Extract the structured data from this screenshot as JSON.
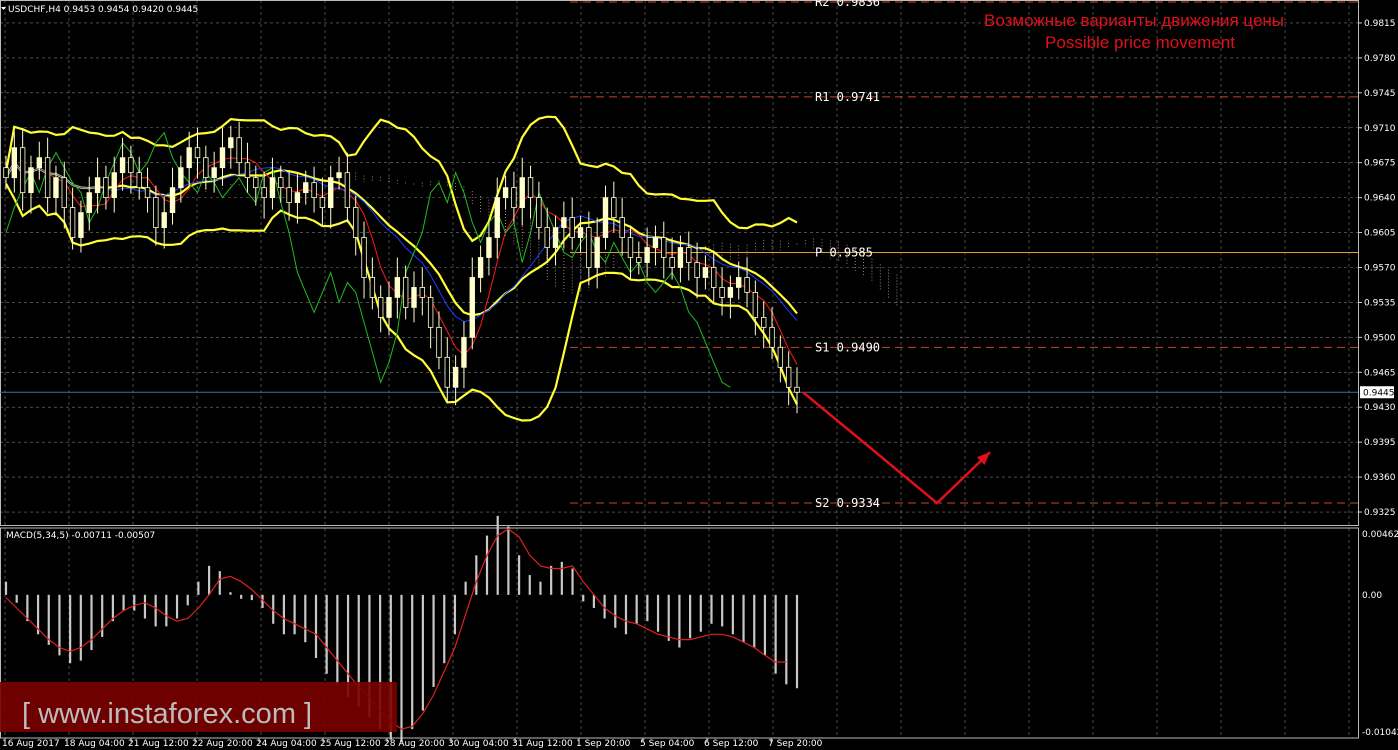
{
  "header": {
    "symbol_line": "USDCHF,H4  0.9453 0.9454 0.9420 0.9445",
    "macd_line": "MACD(5,34,5) -0.00711 -0.00507"
  },
  "title": {
    "line_ru": "Возможные варианты движения цены",
    "line_en": "Possible price movement",
    "color": "#e0101a"
  },
  "watermark": "[ www.instaforex.com ]",
  "colors": {
    "background": "#000000",
    "grid": "#7a7a7a",
    "bollinger": "#ffff33",
    "ichimoku_tenkan": "#ff1a1a",
    "ichimoku_kijun": "#1a3cff",
    "chikou": "#22bb22",
    "bull_candle": "#ffffcc",
    "bear_candle": "#000000",
    "level_line": "#c8462a",
    "pivot_line": "#e0a030",
    "current_price_line": "#4a6a9a",
    "arrow": "#e0101a",
    "macd_hist": "#c8c8c8",
    "macd_signal": "#e02020"
  },
  "chart_data": [
    {
      "type": "line",
      "symbol": "USDCHF",
      "timeframe": "H4",
      "ohlc": {
        "open": 0.9453,
        "high": 0.9454,
        "low": 0.942,
        "close": 0.9445
      },
      "y_axis_ticks": [
        "0.9815",
        "0.9780",
        "0.9745",
        "0.9710",
        "0.9675",
        "0.9640",
        "0.9605",
        "0.9570",
        "0.9535",
        "0.9500",
        "0.9465",
        "0.9430",
        "0.9395",
        "0.9360",
        "0.9325"
      ],
      "ylim": [
        0.9312,
        0.9838
      ],
      "current_price": "0.9445",
      "x_tick_labels": [
        "16 Aug 2017",
        "18 Aug 04:00",
        "21 Aug 12:00",
        "22 Aug 20:00",
        "24 Aug 04:00",
        "25 Aug 12:00",
        "28 Aug 20:00",
        "30 Aug 04:00",
        "31 Aug 12:00",
        "1 Sep 20:00",
        "5 Sep 04:00",
        "6 Sep 12:00",
        "7 Sep 20:00"
      ],
      "pivot_levels": [
        {
          "label": "R2",
          "value": "0.9836"
        },
        {
          "label": "R1",
          "value": "0.9741"
        },
        {
          "label": "P",
          "value": "0.9585"
        },
        {
          "label": "S1",
          "value": "0.9490"
        },
        {
          "label": "S2",
          "value": "0.9334"
        }
      ],
      "projection": {
        "from": 0.9445,
        "to": 0.9334,
        "rebound_to": 0.9385
      },
      "closes": [
        0.966,
        0.969,
        0.9645,
        0.967,
        0.968,
        0.964,
        0.966,
        0.963,
        0.96,
        0.9625,
        0.9645,
        0.966,
        0.964,
        0.9665,
        0.968,
        0.9665,
        0.965,
        0.964,
        0.961,
        0.9625,
        0.965,
        0.967,
        0.969,
        0.968,
        0.966,
        0.967,
        0.969,
        0.97,
        0.9675,
        0.966,
        0.965,
        0.964,
        0.966,
        0.965,
        0.9635,
        0.9645,
        0.9655,
        0.964,
        0.963,
        0.966,
        0.9665,
        0.963,
        0.96,
        0.956,
        0.954,
        0.952,
        0.954,
        0.956,
        0.953,
        0.955,
        0.954,
        0.951,
        0.948,
        0.945,
        0.947,
        0.95,
        0.956,
        0.958,
        0.96,
        0.964,
        0.965,
        0.963,
        0.966,
        0.964,
        0.961,
        0.959,
        0.961,
        0.962,
        0.96,
        0.961,
        0.957,
        0.96,
        0.964,
        0.962,
        0.96,
        0.958,
        0.9575,
        0.959,
        0.96,
        0.958,
        0.957,
        0.959,
        0.9575,
        0.956,
        0.957,
        0.955,
        0.954,
        0.955,
        0.956,
        0.9545,
        0.952,
        0.951,
        0.949,
        0.947,
        0.945,
        0.9445
      ],
      "macd_hist": [
        0.001,
        -0.0006,
        -0.002,
        -0.003,
        -0.0038,
        -0.0046,
        -0.0052,
        -0.005,
        -0.0042,
        -0.0032,
        -0.002,
        -0.0012,
        -0.0012,
        -0.0018,
        -0.0024,
        -0.0024,
        -0.0018,
        -0.0008,
        0.001,
        0.0022,
        0.0018,
        0.0002,
        -0.0003,
        -0.0004,
        -0.001,
        -0.0022,
        -0.003,
        -0.003,
        -0.0036,
        -0.0048,
        -0.006,
        -0.0068,
        -0.0078,
        -0.0085,
        -0.0093,
        -0.0102,
        -0.011,
        -0.0112,
        -0.0102,
        -0.0088,
        -0.007,
        -0.0052,
        -0.003,
        0.001,
        0.003,
        0.0045,
        0.006,
        0.0052,
        0.003,
        0.0015,
        0.001,
        0.0022,
        0.0025,
        0.002,
        -0.0005,
        -0.001,
        -0.0018,
        -0.0025,
        -0.003,
        -0.0022,
        -0.002,
        -0.0028,
        -0.0035,
        -0.004,
        -0.0033,
        -0.0028,
        -0.0022,
        -0.0024,
        -0.003,
        -0.0036,
        -0.004,
        -0.0046,
        -0.006,
        -0.0068,
        -0.0071
      ],
      "macd_signal": [
        -0.0002,
        -0.001,
        -0.0018,
        -0.0026,
        -0.0034,
        -0.004,
        -0.0043,
        -0.004,
        -0.0034,
        -0.0026,
        -0.0018,
        -0.0012,
        -0.0008,
        -0.0006,
        -0.001,
        -0.0016,
        -0.002,
        -0.0018,
        -0.001,
        0.0,
        0.0012,
        0.0014,
        0.001,
        0.0004,
        -0.0004,
        -0.0012,
        -0.0018,
        -0.0022,
        -0.0026,
        -0.003,
        -0.004,
        -0.005,
        -0.006,
        -0.007,
        -0.0078,
        -0.0088,
        -0.0096,
        -0.0102,
        -0.01,
        -0.009,
        -0.0076,
        -0.0058,
        -0.004,
        -0.0015,
        0.001,
        0.003,
        0.0045,
        0.005,
        0.0044,
        0.003,
        0.0022,
        0.002,
        0.002,
        0.0022,
        0.001,
        0.0,
        -0.001,
        -0.0016,
        -0.002,
        -0.0022,
        -0.0026,
        -0.003,
        -0.0032,
        -0.0034,
        -0.0034,
        -0.0032,
        -0.003,
        -0.003,
        -0.0032,
        -0.0036,
        -0.004,
        -0.0046,
        -0.0051,
        -0.0051
      ],
      "macd_axis_ticks": [
        "0.00462",
        "0.00",
        "-0.01042"
      ]
    }
  ]
}
